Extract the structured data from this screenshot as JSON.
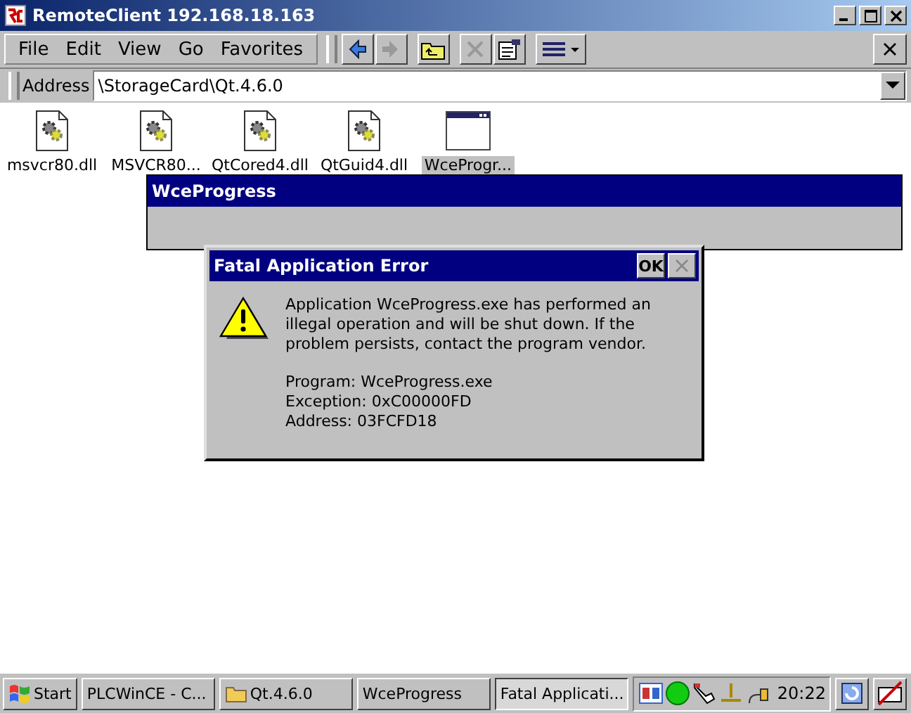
{
  "window": {
    "title": "RemoteClient 192.168.18.163"
  },
  "menu": [
    "File",
    "Edit",
    "View",
    "Go",
    "Favorites"
  ],
  "address": {
    "label": "Address",
    "value": "\\StorageCard\\Qt.4.6.0"
  },
  "files": [
    {
      "name": "msvcr80.dll",
      "kind": "dll",
      "selected": false
    },
    {
      "name": "MSVCR80...",
      "kind": "dll",
      "selected": false
    },
    {
      "name": "QtCored4.dll",
      "kind": "dll",
      "selected": false
    },
    {
      "name": "QtGuid4.dll",
      "kind": "dll",
      "selected": false
    },
    {
      "name": "WceProgr...",
      "kind": "exe",
      "selected": true
    }
  ],
  "progress_window": {
    "title": "WceProgress"
  },
  "dialog": {
    "title": "Fatal Application Error",
    "ok": "OK",
    "message": "Application WceProgress.exe has performed an illegal operation and will be shut down.  If the problem persists, contact the program vendor.",
    "details": [
      "Program: WceProgress.exe",
      "Exception: 0xC00000FD",
      "Address: 03FCFD18"
    ]
  },
  "taskbar": {
    "start": "Start",
    "tasks": [
      {
        "label": "PLCWinCE - C...",
        "folder": false,
        "selected": false
      },
      {
        "label": "Qt.4.6.0",
        "folder": true,
        "selected": false
      },
      {
        "label": "WceProgress",
        "folder": false,
        "selected": false
      },
      {
        "label": "Fatal Applicati...",
        "folder": false,
        "selected": true
      }
    ],
    "clock": "20:22"
  }
}
